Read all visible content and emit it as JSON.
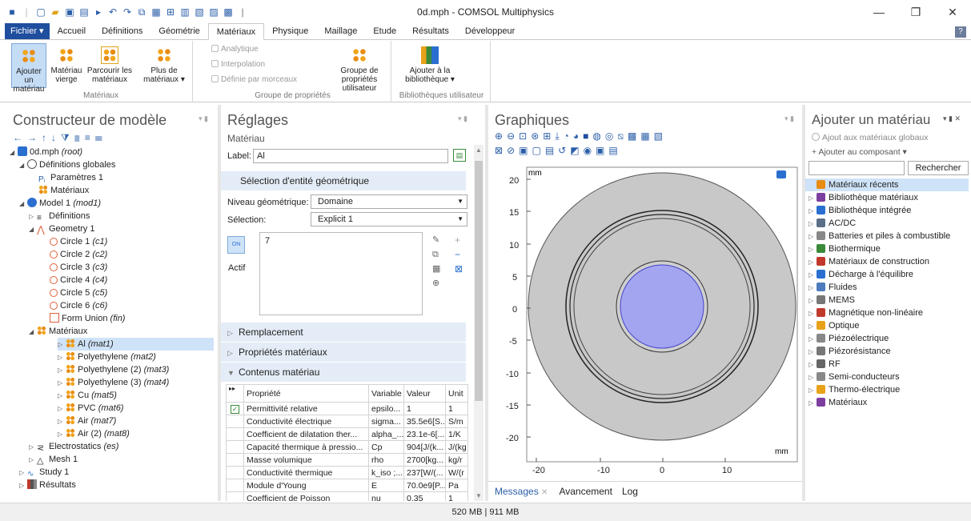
{
  "window": {
    "title": "0d.mph - COMSOL Multiphysics",
    "minimize": "—",
    "maximize": "❐",
    "close": "✕"
  },
  "ribbon_tabs": [
    {
      "label": "Fichier ▾"
    },
    {
      "label": "Accueil"
    },
    {
      "label": "Définitions"
    },
    {
      "label": "Géométrie"
    },
    {
      "label": "Matériaux"
    },
    {
      "label": "Physique"
    },
    {
      "label": "Maillage"
    },
    {
      "label": "Etude"
    },
    {
      "label": "Résultats"
    },
    {
      "label": "Développeur"
    }
  ],
  "help": "?",
  "ribbon": {
    "add_material": "Ajouter un matériau",
    "blank_material": "Matériau vierge",
    "browse_materials": "Parcourir les matériaux",
    "more_materials": "Plus de matériaux ▾",
    "group_materials": "Matériaux",
    "analytic": "Analytique",
    "interpolation": "Interpolation",
    "piecewise": "Définie par morceaux",
    "user_prop_group": "Groupe de propriétés utilisateur",
    "group_properties": "Groupe de propriétés",
    "add_to_library": "Ajouter à la bibliothèque ▾",
    "group_user_libraries": "Bibliothèques utilisateur"
  },
  "model_builder": {
    "title": "Constructeur de modèle",
    "tree": [
      {
        "label": "0d.mph",
        "tag": "(root)"
      },
      {
        "label": "Définitions globales",
        "tag": ""
      },
      {
        "label": "Paramètres 1",
        "tag": ""
      },
      {
        "label": "Matériaux",
        "tag": ""
      },
      {
        "label": "Model 1",
        "tag": "(mod1)"
      },
      {
        "label": "Définitions",
        "tag": ""
      },
      {
        "label": "Geometry 1",
        "tag": ""
      },
      {
        "label": "Circle 1",
        "tag": "(c1)"
      },
      {
        "label": "Circle 2",
        "tag": "(c2)"
      },
      {
        "label": "Circle 3",
        "tag": "(c3)"
      },
      {
        "label": "Circle 4",
        "tag": "(c4)"
      },
      {
        "label": "Circle 5",
        "tag": "(c5)"
      },
      {
        "label": "Circle 6",
        "tag": "(c6)"
      },
      {
        "label": "Form Union",
        "tag": "(fin)"
      },
      {
        "label": "Matériaux",
        "tag": ""
      },
      {
        "label": "Al",
        "tag": "(mat1)"
      },
      {
        "label": "Polyethylene",
        "tag": "(mat2)"
      },
      {
        "label": "Polyethylene (2)",
        "tag": "(mat3)"
      },
      {
        "label": "Polyethylene (3)",
        "tag": "(mat4)"
      },
      {
        "label": "Cu",
        "tag": "(mat5)"
      },
      {
        "label": "PVC",
        "tag": "(mat6)"
      },
      {
        "label": "Air",
        "tag": "(mat7)"
      },
      {
        "label": "Air (2)",
        "tag": "(mat8)"
      },
      {
        "label": "Electrostatics",
        "tag": "(es)"
      },
      {
        "label": "Mesh 1",
        "tag": ""
      },
      {
        "label": "Study 1",
        "tag": ""
      },
      {
        "label": "Résultats",
        "tag": ""
      }
    ]
  },
  "settings": {
    "title": "Réglages",
    "subtitle": "Matériau",
    "label_caption": "Label:",
    "label_value": "Al",
    "geom_selection": "Sélection d'entité géométrique",
    "geom_level_caption": "Niveau géométrique:",
    "geom_level_value": "Domaine",
    "selection_caption": "Sélection:",
    "selection_value": "Explicit 1",
    "selection_item": "7",
    "active_label": "Actif",
    "toggle_text": "ON",
    "sections": {
      "replacement": "Remplacement",
      "material_properties": "Propriétés matériaux",
      "material_contents": "Contenus matériau"
    },
    "table_headers": [
      "Propriété",
      "Variable",
      "Valeur",
      "Unit"
    ],
    "table_rows": [
      {
        "checked": true,
        "prop": "Permittivité relative",
        "var": "epsilo...",
        "val": "1",
        "unit": "1"
      },
      {
        "checked": false,
        "prop": "Conductivité électrique",
        "var": "sigma...",
        "val": "35.5e6[S...",
        "unit": "S/m"
      },
      {
        "checked": false,
        "prop": "Coefficient de dilatation ther...",
        "var": "alpha_...",
        "val": "23.1e-6[...",
        "unit": "1/K"
      },
      {
        "checked": false,
        "prop": "Capacité thermique à pressio...",
        "var": "Cp",
        "val": "904[J/(k...",
        "unit": "J/(kg"
      },
      {
        "checked": false,
        "prop": "Masse volumique",
        "var": "rho",
        "val": "2700[kg...",
        "unit": "kg/r"
      },
      {
        "checked": false,
        "prop": "Conductivité thermique",
        "var": "k_iso ;...",
        "val": "237[W/(...",
        "unit": "W/(r"
      },
      {
        "checked": false,
        "prop": "Module d'Young",
        "var": "E",
        "val": "70.0e9[P...",
        "unit": "Pa"
      },
      {
        "checked": false,
        "prop": "Coefficient de Poisson",
        "var": "nu",
        "val": "0.35",
        "unit": "1"
      }
    ]
  },
  "graphics": {
    "title": "Graphiques",
    "unit_top": "mm",
    "unit_bottom": "mm",
    "y_ticks": [
      "20",
      "15",
      "10",
      "5",
      "0",
      "-5",
      "-10",
      "-15",
      "-20"
    ],
    "x_ticks": [
      "-20",
      "-10",
      "0",
      "10"
    ],
    "colors": {
      "outer": "#c8c8c8",
      "inner_selected": "#a4a5f0",
      "ring": "#cfcfcf"
    }
  },
  "messages_tabs": [
    "Messages",
    "Avancement",
    "Log"
  ],
  "add_material": {
    "title": "Ajouter un matériau",
    "global_add": "Ajout aux matériaux globaux",
    "component_add": "+ Ajouter au composant ▾",
    "search_button": "Rechercher",
    "search_value": "",
    "items": [
      {
        "label": "Matériaux récents",
        "color": "#e88c12"
      },
      {
        "label": "Bibliothèque matériaux",
        "color": "#7c3fa0"
      },
      {
        "label": "Bibliothèque intégrée",
        "color": "#2a6fd0"
      },
      {
        "label": "AC/DC",
        "color": "#5c6f88"
      },
      {
        "label": "Batteries et piles à combustible",
        "color": "#888888"
      },
      {
        "label": "Biothermique",
        "color": "#3a8a3a"
      },
      {
        "label": "Matériaux de construction",
        "color": "#c0392b"
      },
      {
        "label": "Décharge à l'équilibre",
        "color": "#2a6fd0"
      },
      {
        "label": "Fluides",
        "color": "#4d7bbd"
      },
      {
        "label": "MEMS",
        "color": "#777777"
      },
      {
        "label": "Magnétique non-linéaire",
        "color": "#c0392b"
      },
      {
        "label": "Optique",
        "color": "#e8a21a"
      },
      {
        "label": "Piézoélectrique",
        "color": "#888888"
      },
      {
        "label": "Piézorésistance",
        "color": "#777777"
      },
      {
        "label": "RF",
        "color": "#666666"
      },
      {
        "label": "Semi-conducteurs",
        "color": "#888888"
      },
      {
        "label": "Thermo-électrique",
        "color": "#e8a21a"
      },
      {
        "label": "Matériaux",
        "color": "#7c3fa0"
      }
    ]
  },
  "status": {
    "memory": "520 MB | 911 MB"
  }
}
